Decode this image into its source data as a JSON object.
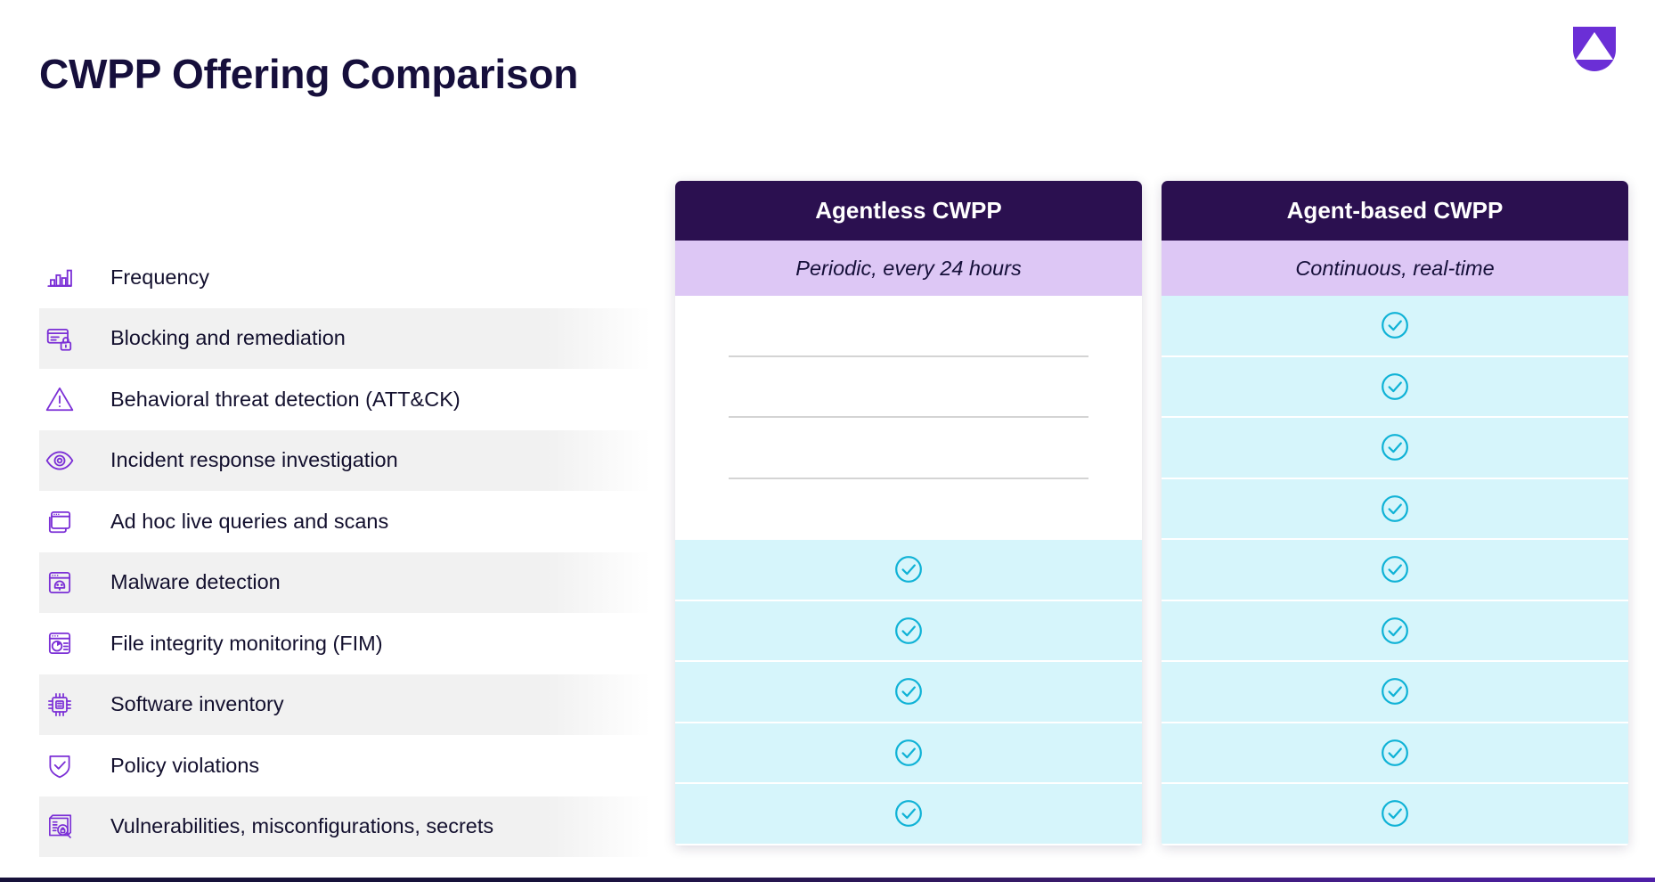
{
  "title": "CWPP Offering Comparison",
  "logo": {
    "name": "company-shield-logo",
    "color": "#6b2fd6"
  },
  "colors": {
    "title": "#160f3c",
    "header_bg": "#2b1050",
    "subhead_bg": "#ddc7f5",
    "yes_cell_bg": "#d6f5fb",
    "check": "#0fb2d6",
    "icon_purple": "#7b2fd6",
    "band": "#f1f1f1"
  },
  "rows": [
    {
      "icon": "bar-chart-icon",
      "label": "Frequency"
    },
    {
      "icon": "card-lock-icon",
      "label": "Blocking and remediation"
    },
    {
      "icon": "warning-triangle-icon",
      "label": "Behavioral threat detection (ATT&CK)"
    },
    {
      "icon": "eye-icon",
      "label": "Incident response investigation"
    },
    {
      "icon": "windows-stack-icon",
      "label": "Ad hoc live queries and scans"
    },
    {
      "icon": "browser-skull-icon",
      "label": "Malware detection"
    },
    {
      "icon": "browser-chart-icon",
      "label": "File integrity monitoring (FIM)"
    },
    {
      "icon": "cpu-chip-icon",
      "label": "Software inventory"
    },
    {
      "icon": "shield-check-icon",
      "label": "Policy violations"
    },
    {
      "icon": "server-search-lock-icon",
      "label": "Vulnerabilities, misconfigurations, secrets"
    }
  ],
  "columns": [
    {
      "id": "agentless",
      "header": "Agentless CWPP",
      "subhead": "Periodic, every 24 hours",
      "values": [
        null,
        false,
        false,
        false,
        false,
        true,
        true,
        true,
        true,
        true
      ]
    },
    {
      "id": "agent-based",
      "header": "Agent-based CWPP",
      "subhead": "Continuous, real-time",
      "values": [
        null,
        true,
        true,
        true,
        true,
        true,
        true,
        true,
        true,
        true
      ]
    }
  ],
  "check_glyph": "circle-check-icon"
}
